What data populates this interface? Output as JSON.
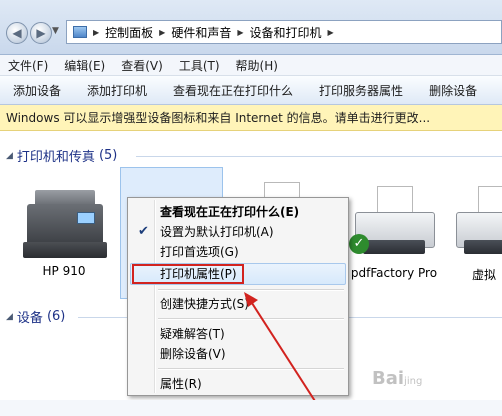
{
  "address": {
    "crumbs": [
      "控制面板",
      "硬件和声音",
      "设备和打印机"
    ]
  },
  "menubar": [
    "文件(F)",
    "编辑(E)",
    "查看(V)",
    "工具(T)",
    "帮助(H)"
  ],
  "commandbar": [
    "添加设备",
    "添加打印机",
    "查看现在正在打印什么",
    "打印服务器属性",
    "删除设备"
  ],
  "infobar": {
    "text": "Windows 可以显示增强型设备图标和来自 Internet 的信息。请单击进行更改..."
  },
  "groups": {
    "printers": {
      "label": "打印机和传真",
      "count": "(5)"
    },
    "devices": {
      "label": "设备",
      "count": "(6)"
    }
  },
  "devices": [
    {
      "label": "HP 910"
    },
    {
      "label": "pdfFactory Pro"
    },
    {
      "label": "虚拟"
    }
  ],
  "context_menu": {
    "items": [
      {
        "label": "查看现在正在打印什么(E)",
        "bold": true
      },
      {
        "label": "设置为默认打印机(A)",
        "checked": true
      },
      {
        "label": "打印首选项(G)"
      },
      {
        "label": "打印机属性(P)",
        "highlighted": true
      },
      {
        "label": "创建快捷方式(S)"
      },
      {
        "label": "疑难解答(T)"
      },
      {
        "label": "删除设备(V)"
      },
      {
        "label": "属性(R)"
      }
    ]
  },
  "watermark": {
    "text": "Bai",
    "tail": "jing"
  },
  "colors": {
    "annotation": "#d2231f",
    "group_header": "#1e3287",
    "infobar": "#fff4b8"
  },
  "icons": [
    "back-icon",
    "forward-icon",
    "control-panel-icon",
    "printer-icon",
    "checkmark-icon"
  ]
}
